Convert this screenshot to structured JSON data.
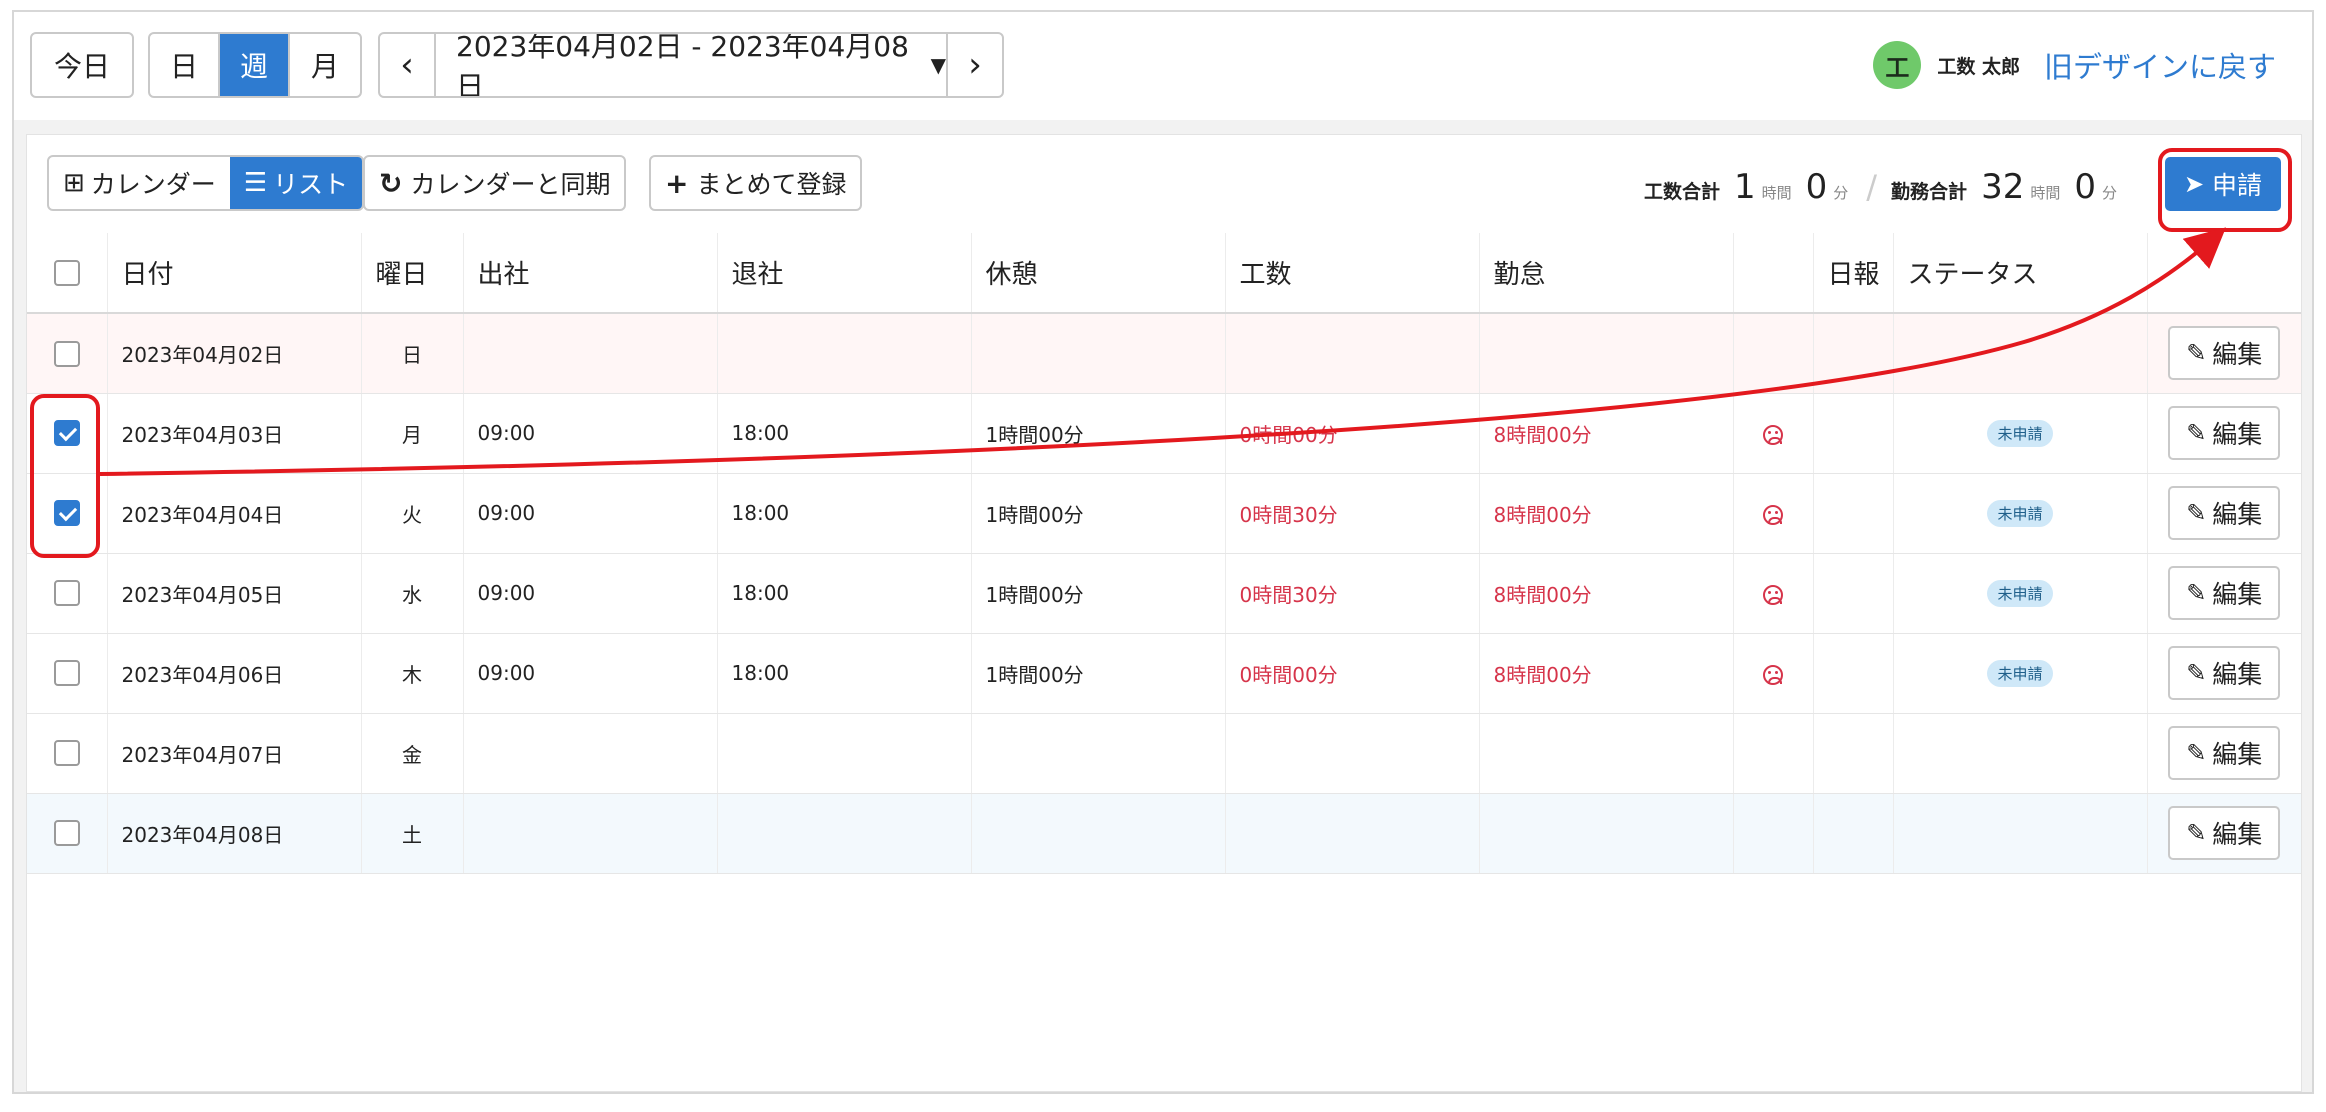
{
  "nav": {
    "today": "今日",
    "view_day": "日",
    "view_week": "週",
    "view_month": "月",
    "prev": "‹",
    "next": "›",
    "date_range": "2023年04月02日 - 2023年04月08日",
    "dropdown_icon": "caret-down-icon"
  },
  "user": {
    "avatar_initial": "工",
    "avatar_color": "#6fc96a",
    "name": "工数 太郎",
    "legacy_link": "旧デザインに戻す"
  },
  "toolbar": {
    "calendar_label": "カレンダー",
    "list_label": "リスト",
    "sync_label": "カレンダーと同期",
    "bulk_label": "まとめて登録",
    "apply_label": "申請"
  },
  "totals": {
    "work_label": "工数合計",
    "work_hours": "1",
    "hour_unit": "時間",
    "work_minutes": "0",
    "minute_unit": "分",
    "attendance_label": "勤務合計",
    "attendance_hours": "32",
    "attendance_minutes": "0"
  },
  "table": {
    "headers": [
      "日付",
      "曜日",
      "出社",
      "退社",
      "休憩",
      "工数",
      "勤怠",
      "",
      "日報",
      "ステータス",
      ""
    ],
    "edit_label": "編集",
    "rows": [
      {
        "date": "2023年04月02日",
        "weekday": "日",
        "in": "",
        "out": "",
        "break": "",
        "work": "",
        "attendance": "",
        "mood": "",
        "status": "",
        "checked": false
      },
      {
        "date": "2023年04月03日",
        "weekday": "月",
        "in": "09:00",
        "out": "18:00",
        "break": "1時間00分",
        "work": "0時間00分",
        "attendance": "8時間00分",
        "mood": "sad-face-icon",
        "status": "未申請",
        "checked": true
      },
      {
        "date": "2023年04月04日",
        "weekday": "火",
        "in": "09:00",
        "out": "18:00",
        "break": "1時間00分",
        "work": "0時間30分",
        "attendance": "8時間00分",
        "mood": "sad-face-icon",
        "status": "未申請",
        "checked": true
      },
      {
        "date": "2023年04月05日",
        "weekday": "水",
        "in": "09:00",
        "out": "18:00",
        "break": "1時間00分",
        "work": "0時間30分",
        "attendance": "8時間00分",
        "mood": "sad-face-icon",
        "status": "未申請",
        "checked": false
      },
      {
        "date": "2023年04月06日",
        "weekday": "木",
        "in": "09:00",
        "out": "18:00",
        "break": "1時間00分",
        "work": "0時間00分",
        "attendance": "8時間00分",
        "mood": "sad-face-icon",
        "status": "未申請",
        "checked": false
      },
      {
        "date": "2023年04月07日",
        "weekday": "金",
        "in": "",
        "out": "",
        "break": "",
        "work": "",
        "attendance": "",
        "mood": "",
        "status": "",
        "checked": false
      },
      {
        "date": "2023年04月08日",
        "weekday": "土",
        "in": "",
        "out": "",
        "break": "",
        "work": "",
        "attendance": "",
        "mood": "",
        "status": "",
        "checked": false
      }
    ]
  },
  "colors": {
    "accent": "#2e7bd0",
    "alert_red": "#d6344a",
    "annotation_red": "#e3191e"
  }
}
